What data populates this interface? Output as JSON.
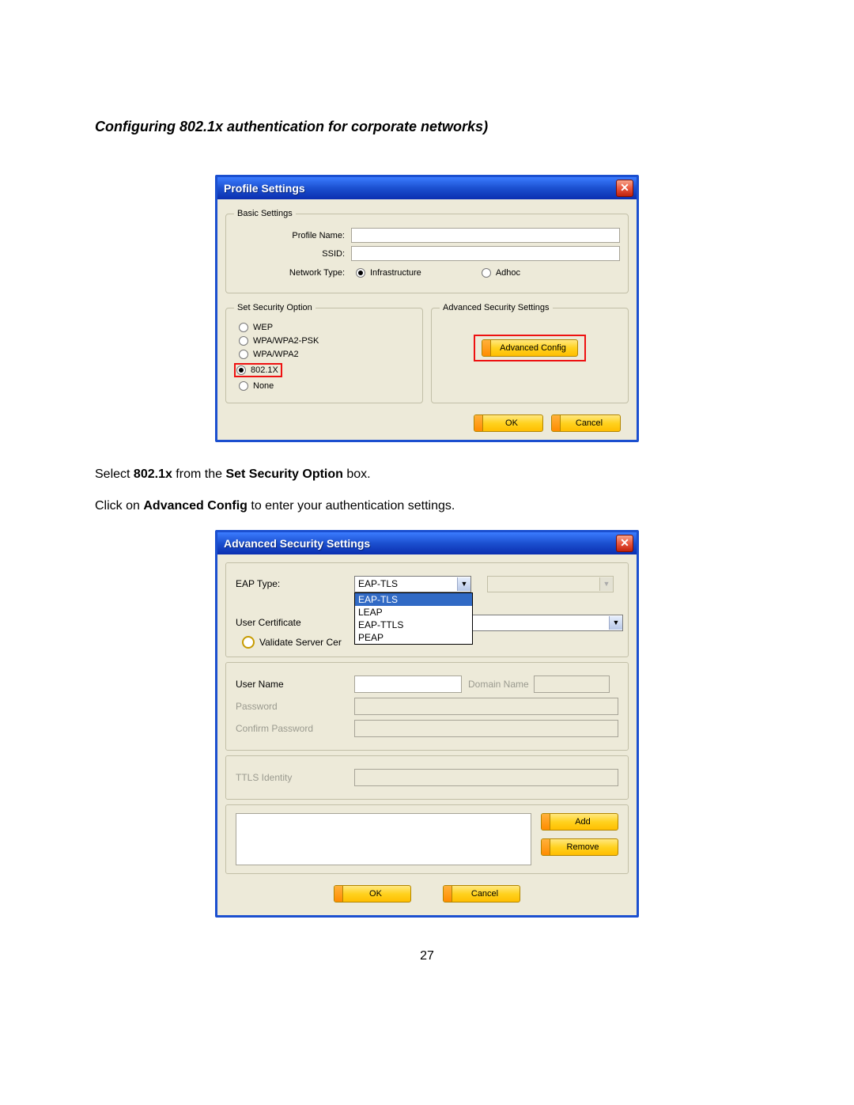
{
  "heading": "Configuring 802.1x authentication for corporate networks)",
  "dialog1": {
    "title": "Profile Settings",
    "basic_legend": "Basic Settings",
    "profile_name_label": "Profile Name:",
    "ssid_label": "SSID:",
    "network_type_label": "Network Type:",
    "nt_infra": "Infrastructure",
    "nt_adhoc": "Adhoc",
    "sec_legend": "Set Security Option",
    "sec_options": [
      "WEP",
      "WPA/WPA2-PSK",
      "WPA/WPA2",
      "802.1X",
      "None"
    ],
    "adv_legend": "Advanced Security Settings",
    "adv_btn": "Advanced Config",
    "ok": "OK",
    "cancel": "Cancel"
  },
  "instr1_a": "Select ",
  "instr1_b": "802.1x",
  "instr1_c": " from the ",
  "instr1_d": "Set Security Option",
  "instr1_e": " box.",
  "instr2_a": "Click on ",
  "instr2_b": "Advanced Config",
  "instr2_c": " to enter your authentication settings.",
  "dialog2": {
    "title": "Advanced Security Settings",
    "eap_type_label": "EAP Type:",
    "eap_selected": "EAP-TLS",
    "eap_options": [
      "EAP-TLS",
      "LEAP",
      "EAP-TTLS",
      "PEAP"
    ],
    "user_cert_label": "User Certificate",
    "validate_label": "Validate Server Cer",
    "user_name_label": "User Name",
    "domain_name_label": "Domain Name",
    "password_label": "Password",
    "confirm_pw_label": "Confirm Password",
    "ttls_label": "TTLS Identity",
    "add": "Add",
    "remove": "Remove",
    "ok": "OK",
    "cancel": "Cancel"
  },
  "page_number": "27"
}
